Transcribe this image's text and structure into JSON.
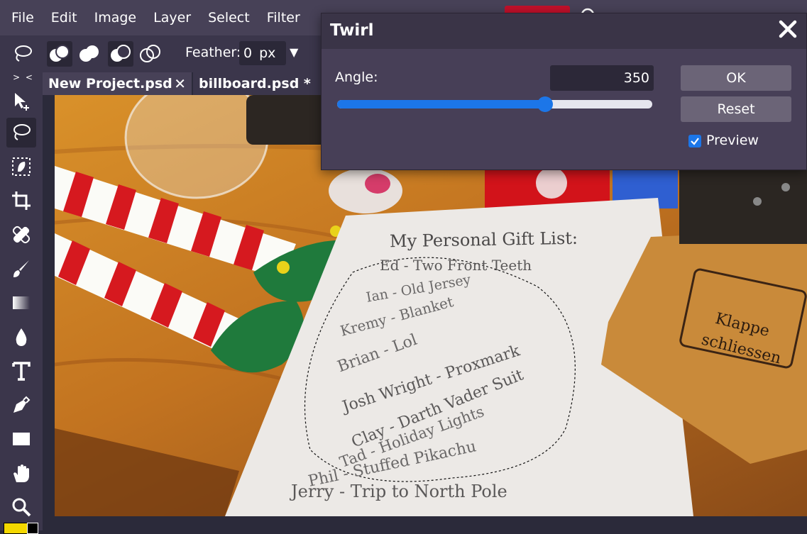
{
  "menu": {
    "items": [
      "File",
      "Edit",
      "Image",
      "Layer",
      "Select",
      "Filter"
    ]
  },
  "options": {
    "feather_label": "Feather:",
    "feather_value": "0",
    "feather_unit": "px"
  },
  "toolbar": {
    "collapse_label": "> <"
  },
  "tabs": [
    {
      "label": "New Project.psd",
      "close": "✕"
    },
    {
      "label": "billboard.psd *",
      "close": "✕"
    }
  ],
  "canvas": {
    "gift_list_title": "My Personal Gift List:",
    "lines": [
      "Ed - Two Front Teeth",
      "Ian - Old Jersey",
      "Kremy - Blanket",
      "Brian - Lol",
      "Josh Wright - Proxmark",
      "Clay - Darth Vader Suit",
      "Tad - Holiday Lights",
      "Phil - Stuffed Pikachu",
      "Jerry - Trip to North Pole"
    ],
    "box_text_1": "Klappe",
    "box_text_2": "schliessen"
  },
  "dialog": {
    "title": "Twirl",
    "angle_label": "Angle:",
    "angle_value": "350",
    "slider_fraction": 0.66,
    "ok_label": "OK",
    "reset_label": "Reset",
    "preview_label": "Preview",
    "preview_checked": true
  },
  "colors": {
    "menu_bg": "#474157",
    "accent": "#1c76e8",
    "fg_swatch": "#f4d800",
    "bg_swatch": "#000000"
  }
}
